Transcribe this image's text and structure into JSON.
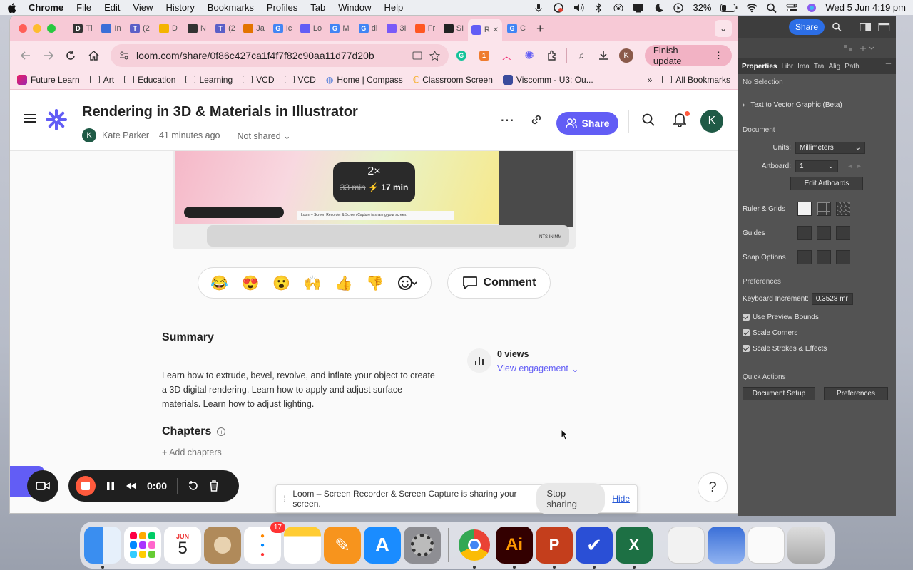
{
  "menubar": {
    "app": "Chrome",
    "items": [
      "File",
      "Edit",
      "View",
      "History",
      "Bookmarks",
      "Profiles",
      "Tab",
      "Window",
      "Help"
    ],
    "battery": "32%",
    "datetime": "Wed 5 Jun  4:19 pm"
  },
  "chrome": {
    "tabs": [
      {
        "title": "Tl",
        "icon": "D",
        "color": "#333"
      },
      {
        "title": "In",
        "icon": "",
        "color": "#3b6fd8"
      },
      {
        "title": "(2",
        "icon": "T",
        "color": "#5b5fc7"
      },
      {
        "title": "D",
        "icon": "",
        "color": "#f4b400"
      },
      {
        "title": "N",
        "icon": "",
        "color": "#333"
      },
      {
        "title": "(2",
        "icon": "T",
        "color": "#5b5fc7"
      },
      {
        "title": "Ja",
        "icon": "",
        "color": "#e37400"
      },
      {
        "title": "Ic",
        "icon": "G",
        "color": "#4285f4"
      },
      {
        "title": "Lo",
        "icon": "",
        "color": "#625df5"
      },
      {
        "title": "M",
        "icon": "G",
        "color": "#4285f4"
      },
      {
        "title": "di",
        "icon": "G",
        "color": "#4285f4"
      },
      {
        "title": "3I",
        "icon": "",
        "color": "#7a5af8"
      },
      {
        "title": "Fr",
        "icon": "",
        "color": "#ff5722"
      },
      {
        "title": "SI",
        "icon": "",
        "color": "#222"
      },
      {
        "title": "R",
        "icon": "",
        "color": "#625df5",
        "active": true
      },
      {
        "title": "C",
        "icon": "G",
        "color": "#4285f4"
      }
    ],
    "url": "loom.com/share/0f86c427ca1f4f7f82c90aa11d77d20b",
    "finish_update": "Finish update",
    "profile_initial": "K",
    "bookmarks": [
      "Future Learn",
      "Art",
      "Education",
      "Learning",
      "VCD",
      "VCD",
      "Home | Compass",
      "Classroom Screen",
      "Viscomm - U3: Ou..."
    ],
    "all_bookmarks": "All Bookmarks"
  },
  "loom": {
    "title": "Rendering in 3D & Materials in Illustrator",
    "author": "Kate Parker",
    "author_initial": "K",
    "time_ago": "41 minutes ago",
    "share_state": "Not shared",
    "share_button": "Share",
    "avatar_initial": "K",
    "video": {
      "speed": "2×",
      "orig_duration": "33 min",
      "fast_duration": "17 min",
      "mini_share_text": "Loom – Screen Recorder & Screen Capture is sharing your screen.",
      "mini_stop": "Stop sharing",
      "mini_hide": "Hide",
      "mini_time": "0:00",
      "mini_units": "NTS IN MM"
    },
    "reactions": [
      "😂",
      "😍",
      "😮",
      "🙌",
      "👍",
      "👎"
    ],
    "comment": "Comment",
    "summary_heading": "Summary",
    "summary": "Learn how to extrude, bevel, revolve, and inflate your object to create a 3D digital rendering. Learn how to apply and adjust surface materials. Learn how to adjust lighting.",
    "views": "0 views",
    "view_engagement": "View engagement",
    "chapters_heading": "Chapters",
    "add_chapters": "+ Add chapters"
  },
  "recorder": {
    "time": "0:00"
  },
  "share_notice": {
    "text": "Loom – Screen Recorder & Screen Capture is sharing your screen.",
    "stop": "Stop sharing",
    "hide": "Hide"
  },
  "help": "?",
  "illustrator": {
    "share": "Share",
    "tabs": [
      "Properties",
      "Libr",
      "Ima",
      "Tra",
      "Alig",
      "Path"
    ],
    "no_selection": "No Selection",
    "text_to_vector": "Text to Vector Graphic (Beta)",
    "document": "Document",
    "units_label": "Units:",
    "units_value": "Millimeters",
    "artboard_label": "Artboard:",
    "artboard_value": "1",
    "edit_artboards": "Edit Artboards",
    "ruler_grids": "Ruler & Grids",
    "guides": "Guides",
    "snap_options": "Snap Options",
    "preferences_heading": "Preferences",
    "keyboard_increment_label": "Keyboard Increment:",
    "keyboard_increment_value": "0.3528 mr",
    "checks": [
      "Use Preview Bounds",
      "Scale Corners",
      "Scale Strokes & Effects"
    ],
    "quick_actions": "Quick Actions",
    "document_setup": "Document Setup",
    "preferences_btn": "Preferences"
  },
  "dock": {
    "calendar_month": "JUN",
    "calendar_day": "5",
    "reminders_badge": "17"
  },
  "colors": {
    "loom_purple": "#625df5",
    "tab_pink": "#f7c9d6",
    "toolbar_pink": "#fbe4eb",
    "ai_bg": "#535353",
    "rec_red": "#ff5a3d"
  }
}
